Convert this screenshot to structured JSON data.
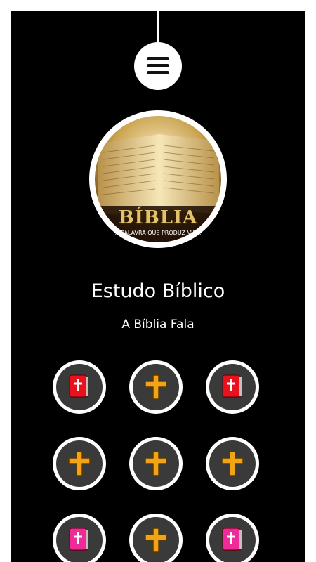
{
  "app": {
    "title": "Estudo Bíblico",
    "subtitle": "A Bíblia Fala"
  },
  "avatar": {
    "wordmark": "BÍBLIA",
    "slogan": "A PALAVRA QUE PRODUZ VIDA"
  },
  "menu": {
    "icon": "hamburger-menu-icon"
  },
  "grid": [
    {
      "icon": "bible-book-icon",
      "color": "#e8111c"
    },
    {
      "icon": "cross-icon",
      "color": "#f0a416"
    },
    {
      "icon": "bible-book-icon",
      "color": "#e8111c"
    },
    {
      "icon": "cross-icon",
      "color": "#f0a416"
    },
    {
      "icon": "cross-icon",
      "color": "#f0a416"
    },
    {
      "icon": "cross-icon",
      "color": "#f0a416"
    },
    {
      "icon": "bible-book-icon",
      "color": "#ef2b9a"
    },
    {
      "icon": "cross-icon",
      "color": "#f0a416"
    },
    {
      "icon": "bible-book-icon",
      "color": "#ef2b9a"
    }
  ],
  "colors": {
    "background": "#000000",
    "button_ring": "#ffffff",
    "button_fill": "#3a3a3a"
  }
}
